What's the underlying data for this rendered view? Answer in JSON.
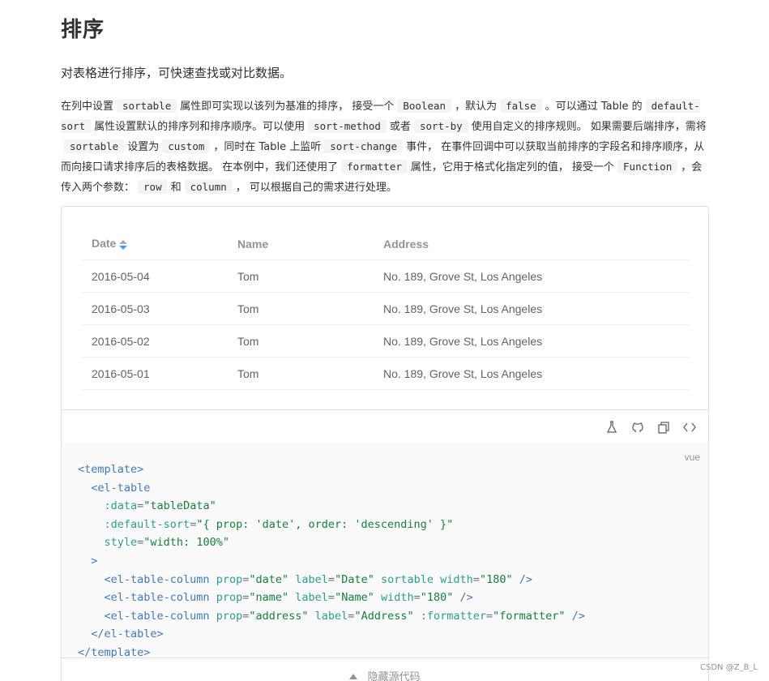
{
  "heading": "排序",
  "subtitle": "对表格进行排序，可快速查找或对比数据。",
  "description": {
    "p1": "在列中设置",
    "c1": "sortable",
    "p2": "属性即可实现以该列为基准的排序， 接受一个",
    "c2": "Boolean",
    "p3": "，默认为",
    "c3": "false",
    "p4": "。可以通过 Table 的",
    "c4": "default-sort",
    "p5": "属性设置默认的排序列和排序顺序。可以使用",
    "c5": "sort-method",
    "p6": "或者",
    "c6": "sort-by",
    "p7": "使用自定义的排序规则。 如果需要后端排序，需将",
    "c7": "sortable",
    "p8": "设置为",
    "c8": "custom",
    "p9": "，同时在 Table 上监听",
    "c9": "sort-change",
    "p10": "事件， 在事件回调中可以获取当前排序的字段名和排序顺序，从而向接口请求排序后的表格数据。 在本例中，我们还使用了",
    "c10": "formatter",
    "p11": "属性，它用于格式化指定列的值， 接受一个",
    "c11": "Function",
    "p12": "，会传入两个参数：",
    "c12": "row",
    "p13": "和",
    "c13": "column",
    "p14": "， 可以根据自己的需求进行处理。"
  },
  "table": {
    "headers": [
      "Date",
      "Name",
      "Address"
    ],
    "rows": [
      [
        "2016-05-04",
        "Tom",
        "No. 189, Grove St, Los Angeles"
      ],
      [
        "2016-05-03",
        "Tom",
        "No. 189, Grove St, Los Angeles"
      ],
      [
        "2016-05-02",
        "Tom",
        "No. 189, Grove St, Los Angeles"
      ],
      [
        "2016-05-01",
        "Tom",
        "No. 189, Grove St, Los Angeles"
      ]
    ]
  },
  "code": {
    "lang": "vue",
    "t1": "<template>",
    "t2": "<el-table",
    "a_data": ":data",
    "v_data": "\"tableData\"",
    "a_sort": ":default-sort",
    "v_sort": "\"{ prop: 'date', order: 'descending' }\"",
    "a_style": "style",
    "v_style": "\"width: 100%\"",
    "close_gt": ">",
    "col": "<el-table-column",
    "a_prop": "prop",
    "a_label": "label",
    "a_sortable": "sortable",
    "a_width": "width",
    "a_formatter": ":formatter",
    "v_date": "\"date\"",
    "v_Date": "\"Date\"",
    "v_180": "\"180\"",
    "v_name": "\"name\"",
    "v_Name": "\"Name\"",
    "v_address": "\"address\"",
    "v_Address": "\"Address\"",
    "v_formatter": "\"formatter\"",
    "selfclose": "/>",
    "end_table": "</el-table>",
    "end_template": "</template>"
  },
  "hide_code_label": "隐藏源代码",
  "watermark": "CSDN @Z_B_L"
}
